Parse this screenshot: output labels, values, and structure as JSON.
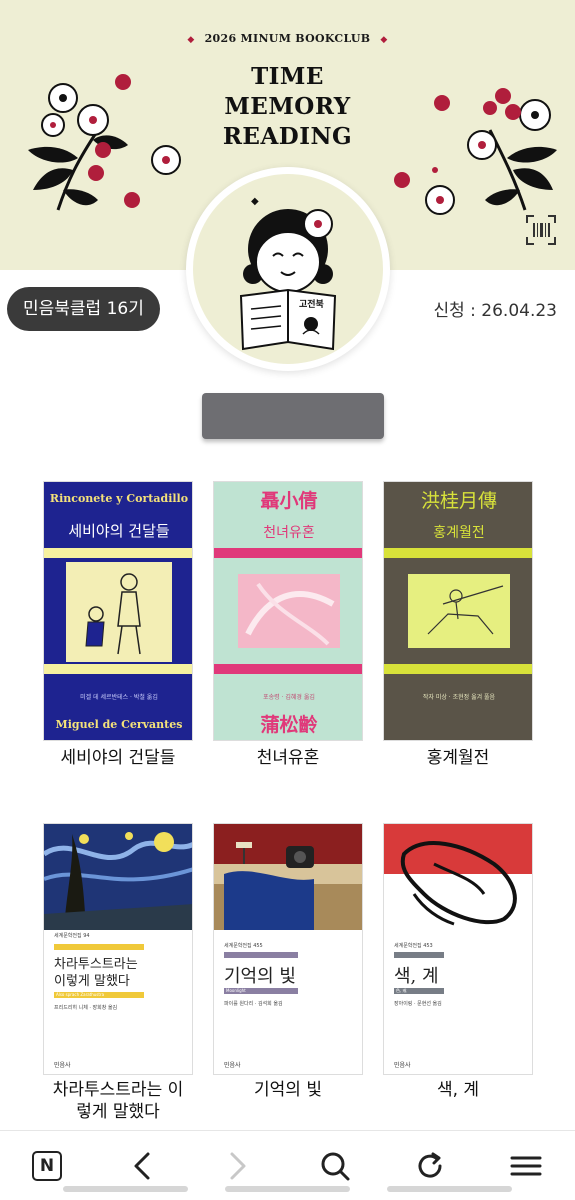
{
  "banner": {
    "club_line": "2026 MINUM BOOKCLUB",
    "title_lines": [
      "TIME",
      "MEMORY",
      "READING"
    ],
    "avatar_book_label": "고전북"
  },
  "club_badge": "민음북클럽 16기",
  "apply_date": "신청 : 26.04.23",
  "books": [
    {
      "title": "세비야의 건달들",
      "cover_top_text": "Rinconete y Cortadillo",
      "cover_title": "세비야의 건달들",
      "cover_author": "미겔 데 세르반테스 · 박철 옮김",
      "cover_bottom_text": "Miguel de Cervantes"
    },
    {
      "title": "천녀유혼",
      "cover_top_text": "聶小倩",
      "cover_title": "천녀유혼",
      "cover_author": "포송령 · 김혜경 옮김",
      "cover_bottom_text": "蒲松齡"
    },
    {
      "title": "홍계월전",
      "cover_top_text": "洪桂月傳",
      "cover_title": "홍계월전",
      "cover_author": "작자 미상 · 조현정 옮겨 풀음"
    },
    {
      "title": "차라투스트라는 이렇게 말했다",
      "title_lines": [
        "차라투스트라는 이",
        "렇게 말했다"
      ],
      "cover_series": "세계문학전집 94",
      "cover_title_lines": [
        "차라투스트라는",
        "이렇게 말했다"
      ],
      "cover_subtitle": "Also sprach Zarathustra",
      "cover_author": "프리드리히 니체 · 장희창 옮김",
      "cover_publisher": "민음사"
    },
    {
      "title": "기억의 빛",
      "cover_series": "세계문학전집 455",
      "cover_title": "기억의 빛",
      "cover_subtitle": "Moonlight",
      "cover_author": "파이를 원다리 · 김석희 옮김",
      "cover_publisher": "민음사"
    },
    {
      "title": "색, 계",
      "cover_series": "세계문학전집 453",
      "cover_title": "색, 계",
      "cover_subtitle": "色, 戒",
      "cover_author": "장아이링 · 문현선 옮김",
      "cover_publisher": "민음사"
    }
  ],
  "bottom_nav": {
    "home_letter": "N",
    "items": [
      "naver-home-icon",
      "back-icon",
      "forward-icon",
      "search-icon",
      "refresh-icon",
      "menu-icon"
    ]
  },
  "colors": {
    "banner_bg": "#eeeed4",
    "berry": "#b01e3c",
    "badge_bg": "#3a3a3a"
  }
}
